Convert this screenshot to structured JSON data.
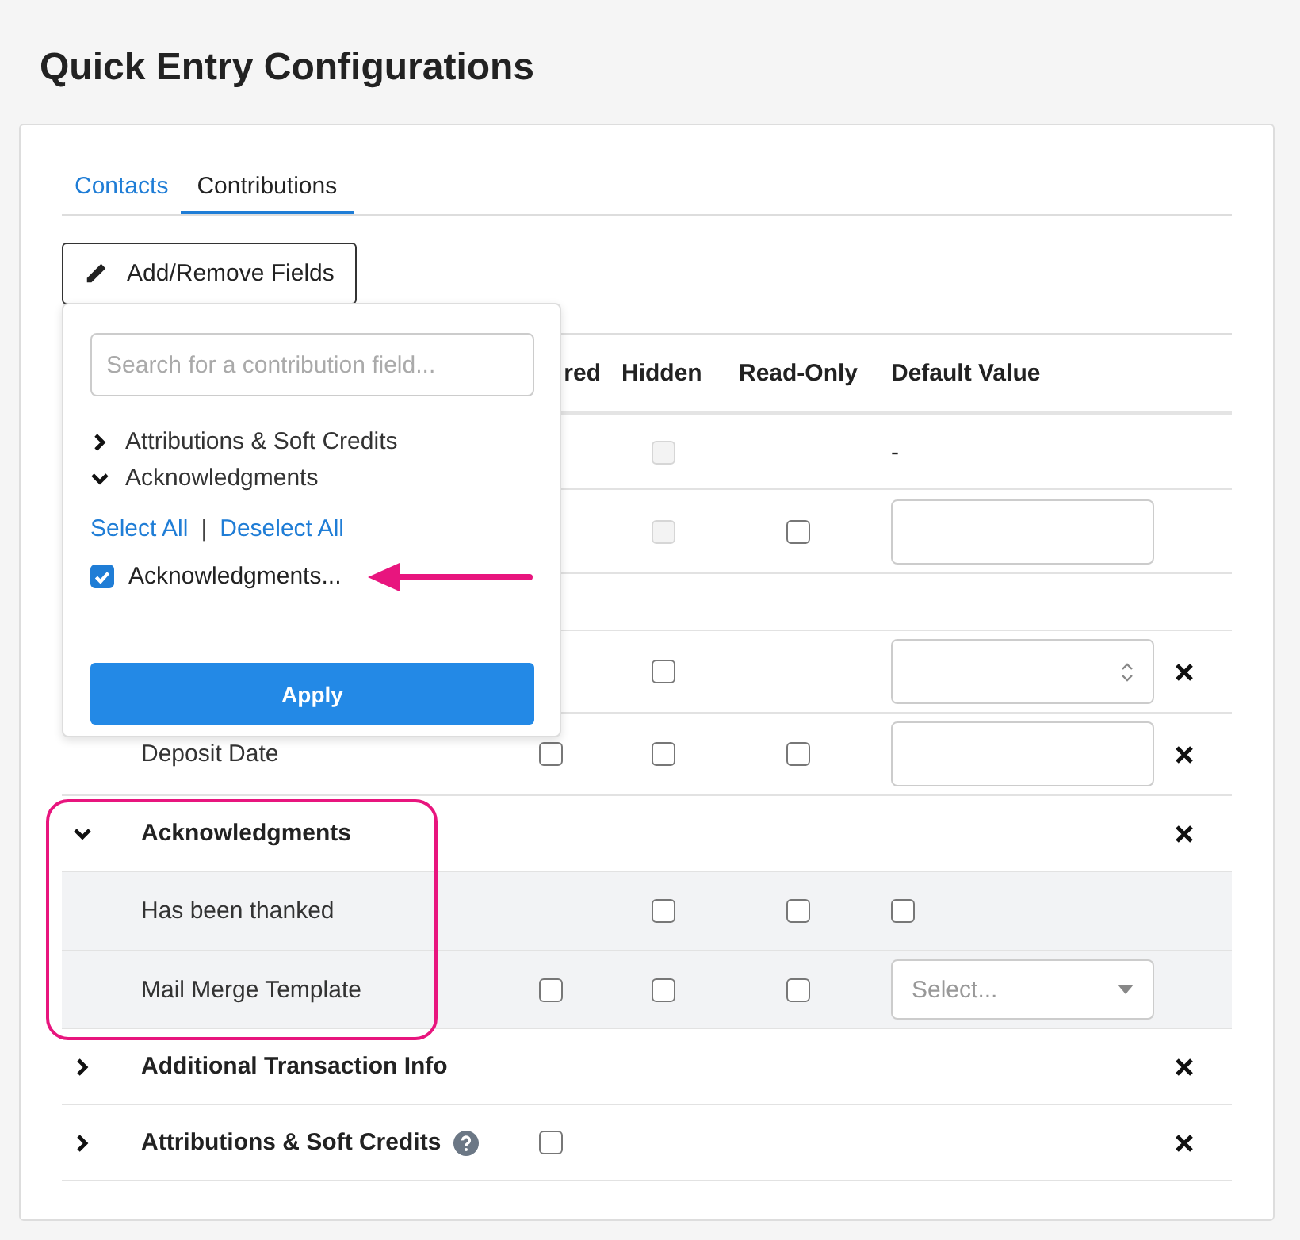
{
  "title": "Quick Entry Configurations",
  "tabs": [
    {
      "label": "Contacts",
      "selected": false
    },
    {
      "label": "Contributions",
      "selected": true
    }
  ],
  "add_button": {
    "label": "Add/Remove Fields"
  },
  "field_picker": {
    "search": {
      "placeholder": "Search for a contribution field..."
    },
    "groups": [
      {
        "label": "Attributions & Soft Credits",
        "expanded": false
      },
      {
        "label": "Acknowledgments",
        "expanded": true
      }
    ],
    "select_all": "Select All",
    "separator": "|",
    "deselect_all": "Deselect All",
    "options": [
      {
        "label": "Acknowledgments...",
        "checked": true
      }
    ],
    "apply_button": "Apply"
  },
  "table": {
    "columns": [
      "red",
      "Hidden",
      "Read-Only",
      "Default Value"
    ],
    "rows": [
      {
        "kind": "field",
        "hidden": {
          "checked": false,
          "disabled": true
        },
        "default": {
          "kind": "text",
          "value": "-"
        }
      },
      {
        "kind": "field",
        "hidden": {
          "checked": false,
          "disabled": true
        },
        "read_only": {
          "checked": false,
          "disabled": false
        },
        "default": {
          "kind": "input"
        }
      },
      {
        "kind": "field"
      },
      {
        "kind": "field",
        "hidden": {
          "checked": false,
          "disabled": false
        },
        "default": {
          "kind": "number"
        },
        "removable": true
      },
      {
        "kind": "field",
        "label": "Deposit Date",
        "required": {
          "checked": false,
          "disabled": false
        },
        "hidden": {
          "checked": false,
          "disabled": false
        },
        "read_only": {
          "checked": false,
          "disabled": false
        },
        "default": {
          "kind": "input"
        },
        "removable": true
      },
      {
        "kind": "group",
        "label": "Acknowledgments",
        "expanded": true,
        "removable": true
      },
      {
        "kind": "child",
        "label": "Has been thanked",
        "hidden": {
          "checked": false,
          "disabled": false
        },
        "read_only": {
          "checked": false,
          "disabled": false
        },
        "default": {
          "kind": "checkbox",
          "checked": false
        }
      },
      {
        "kind": "child",
        "label": "Mail Merge Template",
        "required": {
          "checked": false,
          "disabled": false
        },
        "hidden": {
          "checked": false,
          "disabled": false
        },
        "read_only": {
          "checked": false,
          "disabled": false
        },
        "default": {
          "kind": "select",
          "placeholder": "Select..."
        }
      },
      {
        "kind": "group",
        "label": "Additional Transaction Info",
        "expanded": false,
        "removable": true
      },
      {
        "kind": "group",
        "label": "Attributions & Soft Credits",
        "expanded": false,
        "help": true,
        "required": {
          "checked": false,
          "disabled": false
        },
        "removable": true
      }
    ]
  }
}
